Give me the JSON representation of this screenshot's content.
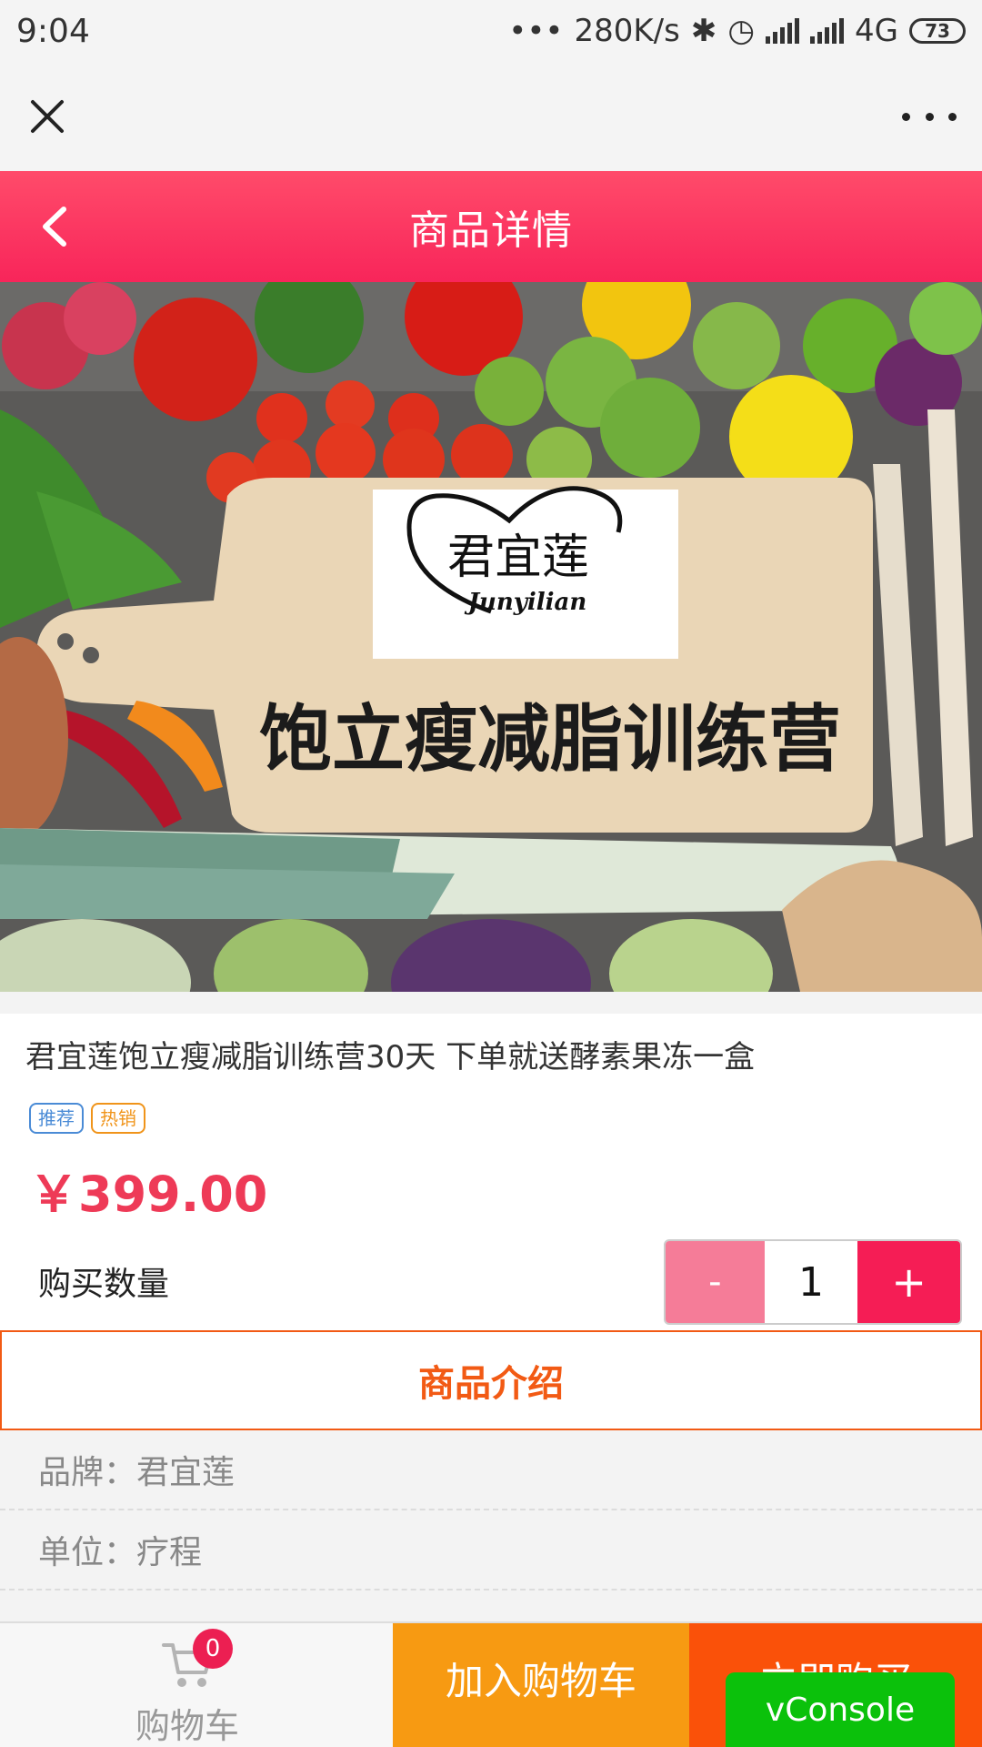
{
  "status_bar": {
    "time": "9:04",
    "speed": "280K/s",
    "network": "4G",
    "battery": "73"
  },
  "webview": {
    "close_icon": "close-icon",
    "more_icon": "more-icon"
  },
  "header": {
    "title": "商品详情",
    "back_icon": "chevron-left-icon"
  },
  "hero": {
    "brand_logo_text": "君宜莲",
    "brand_logo_subtext": "Junyilian",
    "banner_text": "饱立瘦减脂训练营"
  },
  "product": {
    "name": "君宜莲饱立瘦减脂训练营30天 下单就送酵素果冻一盒",
    "tags": [
      "推荐",
      "热销"
    ],
    "price": "￥399.00",
    "quantity_label": "购买数量",
    "quantity": "1",
    "minus": "-",
    "plus": "+"
  },
  "intro": {
    "title": "商品介绍",
    "attributes": [
      "品牌：君宜莲",
      "单位：疗程"
    ]
  },
  "bottom_bar": {
    "cart_label": "购物车",
    "cart_count": "0",
    "add_to_cart": "加入购物车",
    "buy_now": "立即购买"
  },
  "vconsole": "vConsole",
  "colors": {
    "header_red": "#f8255a",
    "price_red": "#ee3a57",
    "accent_orange": "#f25a14",
    "add_cart_orange": "#f79a12",
    "buy_now_orange": "#fa5109",
    "vconsole_green": "#0bc10b"
  }
}
